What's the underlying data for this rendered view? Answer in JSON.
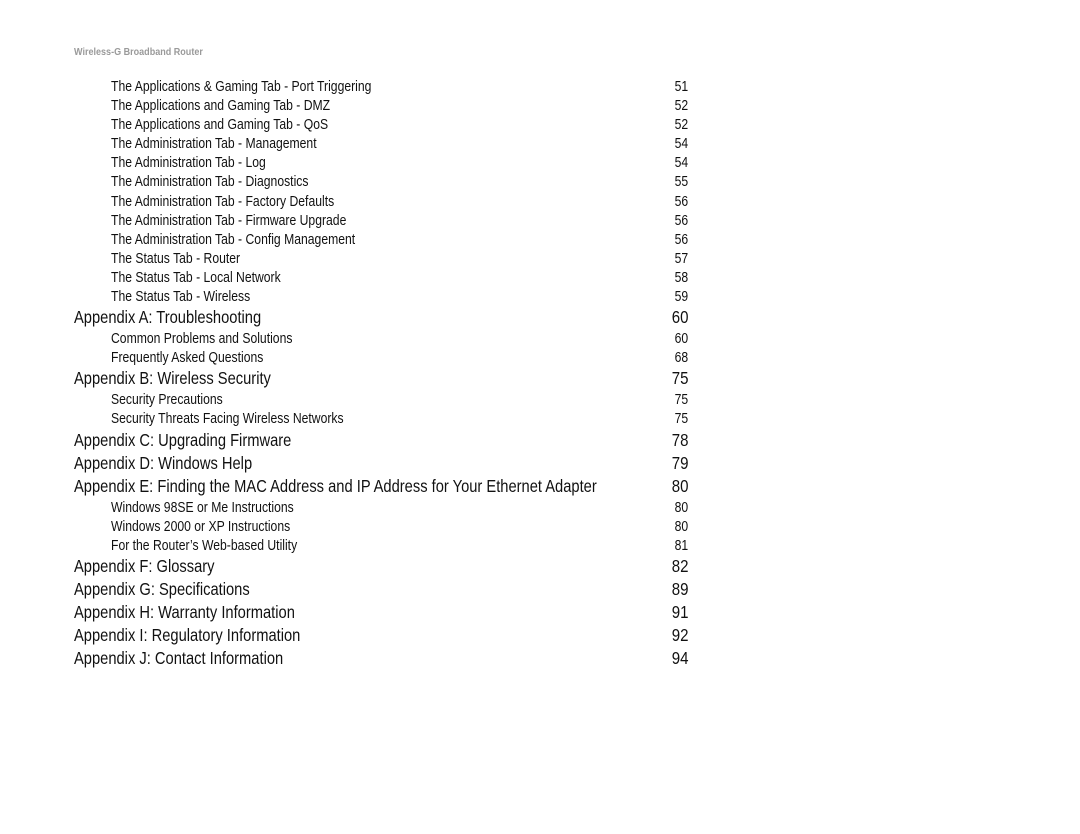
{
  "header": {
    "title": "Wireless-G Broadband Router"
  },
  "toc": [
    {
      "level": "sub",
      "title": "The Applications & Gaming Tab - Port Triggering",
      "page": "51"
    },
    {
      "level": "sub",
      "title": "The Applications and Gaming Tab - DMZ",
      "page": "52"
    },
    {
      "level": "sub",
      "title": "The Applications and Gaming Tab - QoS",
      "page": "52"
    },
    {
      "level": "sub",
      "title": "The Administration Tab - Management",
      "page": "54"
    },
    {
      "level": "sub",
      "title": "The Administration Tab - Log",
      "page": "54"
    },
    {
      "level": "sub",
      "title": "The Administration Tab - Diagnostics",
      "page": "55"
    },
    {
      "level": "sub",
      "title": "The Administration Tab - Factory Defaults",
      "page": "56"
    },
    {
      "level": "sub",
      "title": "The Administration Tab - Firmware Upgrade",
      "page": "56"
    },
    {
      "level": "sub",
      "title": "The Administration Tab - Config Management",
      "page": "56"
    },
    {
      "level": "sub",
      "title": "The Status Tab - Router",
      "page": "57"
    },
    {
      "level": "sub",
      "title": "The Status Tab - Local Network",
      "page": "58"
    },
    {
      "level": "sub",
      "title": "The Status Tab - Wireless",
      "page": "59"
    },
    {
      "level": "app",
      "title": "Appendix A: Troubleshooting",
      "page": "60"
    },
    {
      "level": "sub",
      "title": "Common Problems and Solutions",
      "page": "60"
    },
    {
      "level": "sub",
      "title": "Frequently Asked Questions",
      "page": "68"
    },
    {
      "level": "app",
      "title": "Appendix B: Wireless Security",
      "page": "75"
    },
    {
      "level": "sub",
      "title": "Security Precautions",
      "page": "75"
    },
    {
      "level": "sub",
      "title": "Security Threats Facing Wireless Networks",
      "page": "75"
    },
    {
      "level": "app",
      "title": "Appendix C: Upgrading Firmware",
      "page": "78"
    },
    {
      "level": "app",
      "title": "Appendix D: Windows Help",
      "page": "79"
    },
    {
      "level": "app",
      "title": "Appendix E: Finding the MAC Address and IP Address for Your Ethernet Adapter",
      "page": "80"
    },
    {
      "level": "sub",
      "title": "Windows 98SE or Me Instructions",
      "page": "80"
    },
    {
      "level": "sub",
      "title": "Windows 2000 or XP Instructions",
      "page": "80"
    },
    {
      "level": "sub",
      "title": "For the Router’s Web-based Utility",
      "page": "81"
    },
    {
      "level": "app",
      "title": "Appendix F: Glossary",
      "page": "82"
    },
    {
      "level": "app",
      "title": "Appendix G: Specifications",
      "page": "89"
    },
    {
      "level": "app",
      "title": "Appendix H: Warranty Information",
      "page": "91"
    },
    {
      "level": "app",
      "title": "Appendix I: Regulatory Information",
      "page": "92"
    },
    {
      "level": "app",
      "title": "Appendix J: Contact Information",
      "page": "94"
    }
  ]
}
